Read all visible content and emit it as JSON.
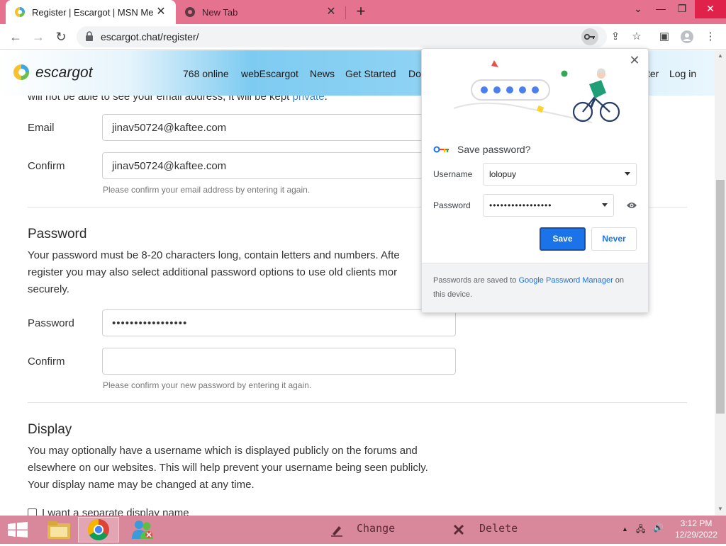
{
  "browser": {
    "tabs": [
      {
        "title": "Register | Escargot | MSN Messe",
        "active": true
      },
      {
        "title": "New Tab",
        "active": false
      }
    ],
    "new_tab_icon": "plus-icon",
    "window_controls": [
      "chevron-down-icon",
      "minimize-icon",
      "restore-icon",
      "close-icon"
    ],
    "url": "escargot.chat/register/",
    "colors": {
      "tab_strip": "#e5738f",
      "close_btn": "#e0224a"
    }
  },
  "site": {
    "logo_text": "escargot",
    "nav": [
      "768 online",
      "webEscargot",
      "News",
      "Get Started",
      "Do",
      "ter",
      "Log in"
    ]
  },
  "form": {
    "partial_line_prefix": "will not be able to see your email address, it will be kept ",
    "partial_line_link": "private",
    "partial_line_suffix": ".",
    "email": {
      "label": "Email",
      "value": "jinav50724@kaftee.com"
    },
    "email_confirm": {
      "label": "Confirm",
      "value": "jinav50724@kaftee.com",
      "hint": "Please confirm your email address by entering it again."
    },
    "password_section": {
      "heading": "Password",
      "desc_lines": [
        "Your password must be 8-20 characters long, contain letters and numbers. Afte",
        "register you may also select additional password options to use old clients mor",
        "securely."
      ]
    },
    "password": {
      "label": "Password",
      "value": "•••••••••••••••••"
    },
    "password_confirm": {
      "label": "Confirm",
      "value": "",
      "hint": "Please confirm your new password by entering it again."
    },
    "display_section": {
      "heading": "Display",
      "desc_lines": [
        "You may optionally have a username which is displayed publicly on the forums and",
        "elsewhere on our websites. This will help prevent your username being seen publicly.",
        "Your display name may be changed at any time."
      ],
      "checkbox_label": "I want a separate display name"
    }
  },
  "password_bubble": {
    "title": "Save password?",
    "username_label": "Username",
    "username_value": "lolopuy",
    "password_label": "Password",
    "password_value": "•••••••••••••••••",
    "save_label": "Save",
    "never_label": "Never",
    "footer_prefix": "Passwords are saved to ",
    "footer_link": "Google Password Manager",
    "footer_suffix": " on this device.",
    "colors": {
      "primary": "#1a73e8"
    }
  },
  "taskbar": {
    "actions": [
      {
        "label": "Change",
        "icon": "pen-icon"
      },
      {
        "label": "Delete",
        "icon": "x-icon"
      }
    ],
    "clock_time": "3:12 PM",
    "clock_date": "12/29/2022",
    "colors": {
      "bar": "#d9879a"
    }
  }
}
